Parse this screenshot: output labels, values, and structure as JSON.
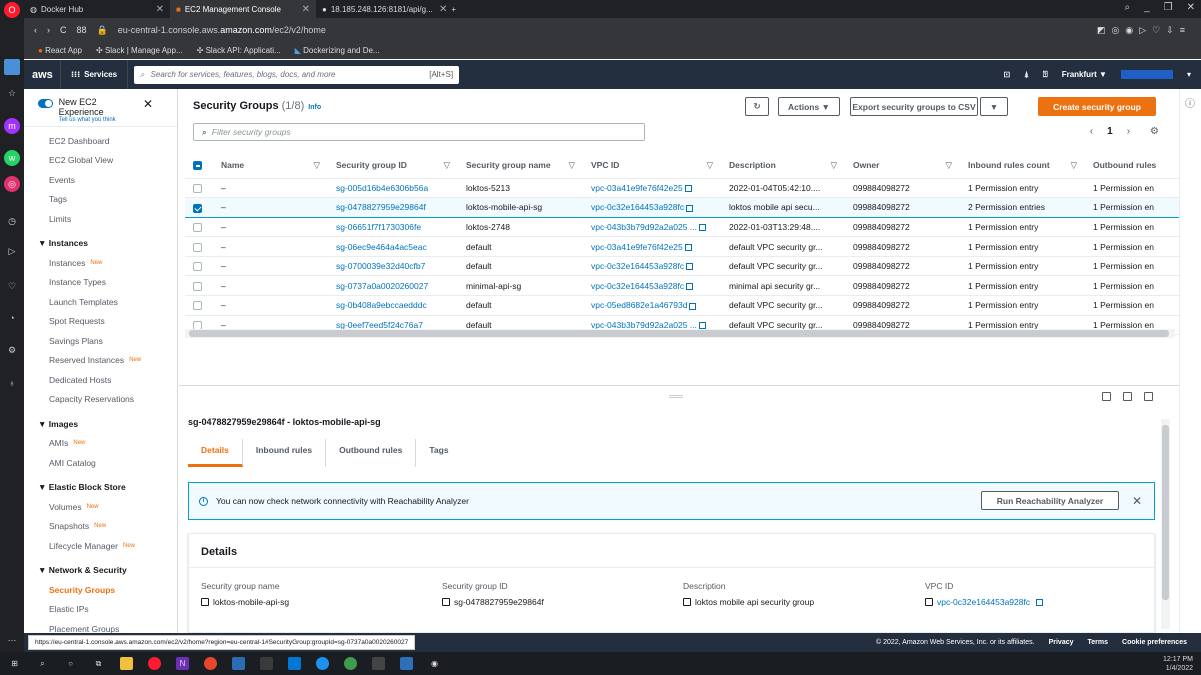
{
  "browser": {
    "tabs": [
      {
        "label": "Docker Hub"
      },
      {
        "label": "EC2 Management Console"
      },
      {
        "label": "18.185.248.126:8181/api/g..."
      }
    ],
    "url_prefix": "eu-central-1.console.aws.",
    "url_domain": "amazon.com",
    "url_path": "/ec2/v2/home",
    "nav_count": "88",
    "bookmarks": [
      {
        "label": "React App"
      },
      {
        "label": "Slack | Manage App..."
      },
      {
        "label": "Slack API: Applicati..."
      },
      {
        "label": "Dockerizing and De..."
      }
    ]
  },
  "awsbar": {
    "logo": "aws",
    "services": "Services",
    "search_placeholder": "Search for services, features, blogs, docs, and more",
    "search_shortcut": "[Alt+S]",
    "region": "Frankfurt ▼"
  },
  "sidebar": {
    "new_exp_title": "New EC2 Experience",
    "new_exp_sub": "Tell us what you think",
    "items": [
      {
        "label": "EC2 Dashboard",
        "badge": ""
      },
      {
        "label": "EC2 Global View",
        "badge": ""
      },
      {
        "label": "Events",
        "badge": ""
      },
      {
        "label": "Tags",
        "badge": ""
      },
      {
        "label": "Limits",
        "badge": ""
      }
    ],
    "sections": [
      {
        "title": "▼ Instances",
        "items": [
          {
            "label": "Instances",
            "badge": "New"
          },
          {
            "label": "Instance Types",
            "badge": ""
          },
          {
            "label": "Launch Templates",
            "badge": ""
          },
          {
            "label": "Spot Requests",
            "badge": ""
          },
          {
            "label": "Savings Plans",
            "badge": ""
          },
          {
            "label": "Reserved Instances",
            "badge": "New"
          },
          {
            "label": "Dedicated Hosts",
            "badge": ""
          },
          {
            "label": "Capacity Reservations",
            "badge": ""
          }
        ]
      },
      {
        "title": "▼ Images",
        "items": [
          {
            "label": "AMIs",
            "badge": "New"
          },
          {
            "label": "AMI Catalog",
            "badge": ""
          }
        ]
      },
      {
        "title": "▼ Elastic Block Store",
        "items": [
          {
            "label": "Volumes",
            "badge": "New"
          },
          {
            "label": "Snapshots",
            "badge": "New"
          },
          {
            "label": "Lifecycle Manager",
            "badge": "New"
          }
        ]
      },
      {
        "title": "▼ Network & Security",
        "items": [
          {
            "label": "Security Groups",
            "badge": ""
          },
          {
            "label": "Elastic IPs",
            "badge": ""
          },
          {
            "label": "Placement Groups",
            "badge": ""
          }
        ]
      }
    ]
  },
  "main": {
    "title": "Security Groups",
    "count": "(1/8)",
    "info": "Info",
    "actions": "Actions ▼",
    "export": "Export security groups to CSV",
    "export_drop": "▼",
    "create": "Create security group",
    "filter_placeholder": "Filter security groups",
    "page": "1",
    "columns": [
      "Name",
      "Security group ID",
      "Security group name",
      "VPC ID",
      "Description",
      "Owner",
      "Inbound rules count",
      "Outbound rules"
    ],
    "rows": [
      {
        "name": "–",
        "sgid": "sg-005d16b4e6306b56a",
        "sgname": "loktos-5213",
        "vpc": "vpc-03a41e9fe76f42e25",
        "desc": "2022-01-04T05:42:10....",
        "owner": "099884098272",
        "inbound": "1 Permission entry",
        "outbound": "1 Permission en",
        "selected": false
      },
      {
        "name": "–",
        "sgid": "sg-0478827959e29864f",
        "sgname": "loktos-mobile-api-sg",
        "vpc": "vpc-0c32e164453a928fc",
        "desc": "loktos mobile api secu...",
        "owner": "099884098272",
        "inbound": "2 Permission entries",
        "outbound": "1 Permission en",
        "selected": true
      },
      {
        "name": "–",
        "sgid": "sg-06651f7f1730306fe",
        "sgname": "loktos-2748",
        "vpc": "vpc-043b3b79d92a2a025 ...",
        "desc": "2022-01-03T13:29:48....",
        "owner": "099884098272",
        "inbound": "1 Permission entry",
        "outbound": "1 Permission en",
        "selected": false
      },
      {
        "name": "–",
        "sgid": "sg-06ec9e464a4ac5eac",
        "sgname": "default",
        "vpc": "vpc-03a41e9fe76f42e25",
        "desc": "default VPC security gr...",
        "owner": "099884098272",
        "inbound": "1 Permission entry",
        "outbound": "1 Permission en",
        "selected": false
      },
      {
        "name": "–",
        "sgid": "sg-0700039e32d40cfb7",
        "sgname": "default",
        "vpc": "vpc-0c32e164453a928fc",
        "desc": "default VPC security gr...",
        "owner": "099884098272",
        "inbound": "1 Permission entry",
        "outbound": "1 Permission en",
        "selected": false
      },
      {
        "name": "–",
        "sgid": "sg-0737a0a0020260027",
        "sgname": "minimal-api-sg",
        "vpc": "vpc-0c32e164453a928fc",
        "desc": "minimal api security gr...",
        "owner": "099884098272",
        "inbound": "1 Permission entry",
        "outbound": "1 Permission en",
        "selected": false
      },
      {
        "name": "–",
        "sgid": "sg-0b408a9ebccaedddc",
        "sgname": "default",
        "vpc": "vpc-05ed8682e1a46793d",
        "desc": "default VPC security gr...",
        "owner": "099884098272",
        "inbound": "1 Permission entry",
        "outbound": "1 Permission en",
        "selected": false
      },
      {
        "name": "–",
        "sgid": "sg-0eef7eed5f24c76a7",
        "sgname": "default",
        "vpc": "vpc-043b3b79d92a2a025 ...",
        "desc": "default VPC security gr...",
        "owner": "099884098272",
        "inbound": "1 Permission entry",
        "outbound": "1 Permission en",
        "selected": false
      }
    ]
  },
  "detail": {
    "heading": "sg-0478827959e29864f - loktos-mobile-api-sg",
    "tabs": [
      "Details",
      "Inbound rules",
      "Outbound rules",
      "Tags"
    ],
    "alert": "You can now check network connectivity with Reachability Analyzer",
    "run_btn": "Run Reachability Analyzer",
    "box_title": "Details",
    "fields": [
      {
        "k": "Security group name",
        "v": "loktos-mobile-api-sg"
      },
      {
        "k": "Security group ID",
        "v": "sg-0478827959e29864f"
      },
      {
        "k": "Description",
        "v": "loktos mobile api security group"
      },
      {
        "k": "VPC ID",
        "v": "vpc-0c32e164453a928fc"
      }
    ]
  },
  "status": {
    "hover_url": "https://eu-central-1.console.aws.amazon.com/ec2/v2/home?region=eu-central-1#SecurityGroup:groupId=sg-0737a0a0020260027",
    "copyright": "© 2022, Amazon Web Services, Inc. or its affiliates.",
    "privacy": "Privacy",
    "terms": "Terms",
    "cookies": "Cookie preferences"
  },
  "taskbar": {
    "time": "12:17 PM",
    "date": "1/4/2022"
  },
  "colors": {
    "accent": "#ec7211",
    "link": "#0073bb",
    "nav": "#232f3e"
  }
}
